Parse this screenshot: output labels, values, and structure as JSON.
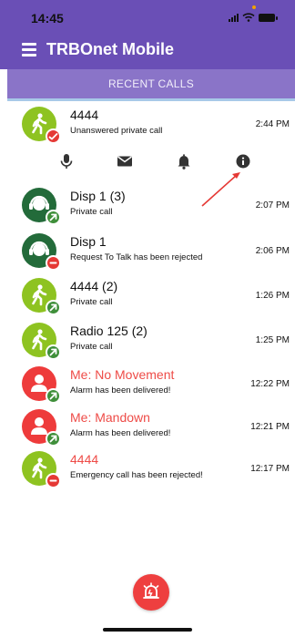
{
  "status_bar": {
    "time": "14:45"
  },
  "app": {
    "title": "TRBOnet Mobile"
  },
  "tab": {
    "label": "RECENT CALLS"
  },
  "calls": [
    {
      "name": "4444",
      "desc": "Unanswered private call",
      "time": "2:44 PM",
      "avatar": "radio-user",
      "avatar_color": "#8ec321",
      "badge": "missed-call",
      "name_color": "#111111"
    },
    {
      "name": "Disp 1 (3)",
      "desc": "Private call",
      "time": "2:07 PM",
      "avatar": "dispatcher-headset",
      "avatar_color": "#236b3a",
      "badge": "outgoing-call",
      "name_color": "#111111"
    },
    {
      "name": "Disp 1",
      "desc": "Request To Talk has been rejected",
      "time": "2:06 PM",
      "avatar": "dispatcher-headset",
      "avatar_color": "#236b3a",
      "badge": "rejected",
      "name_color": "#111111"
    },
    {
      "name": "4444 (2)",
      "desc": "Private call",
      "time": "1:26 PM",
      "avatar": "radio-user",
      "avatar_color": "#8ec321",
      "badge": "outgoing-call",
      "name_color": "#111111"
    },
    {
      "name": "Radio 125 (2)",
      "desc": "Private call",
      "time": "1:25 PM",
      "avatar": "radio-user",
      "avatar_color": "#8ec321",
      "badge": "outgoing-call",
      "name_color": "#111111"
    },
    {
      "name": "Me: No Movement",
      "desc": "Alarm has been delivered!",
      "time": "12:22 PM",
      "avatar": "person",
      "avatar_color": "#ee3b3b",
      "badge": "outgoing-call",
      "name_color": "#ee4b47"
    },
    {
      "name": "Me: Mandown",
      "desc": "Alarm has been delivered!",
      "time": "12:21 PM",
      "avatar": "person",
      "avatar_color": "#ee3b3b",
      "badge": "outgoing-call",
      "name_color": "#ee4b47"
    },
    {
      "name": "4444",
      "desc": "Emergency call has been rejected!",
      "time": "12:17 PM",
      "avatar": "radio-user",
      "avatar_color": "#8ec321",
      "badge": "rejected",
      "name_color": "#ee4b47"
    }
  ],
  "actions": [
    "microphone-icon",
    "message-icon",
    "bell-icon",
    "info-icon"
  ],
  "fab": {
    "icon": "emergency-alarm-icon",
    "color": "#ee3f3f"
  },
  "colors": {
    "primary": "#6a4fb6",
    "tab": "#8a74c8",
    "accent_red": "#ee3f3f",
    "annotation": "#e53935"
  }
}
